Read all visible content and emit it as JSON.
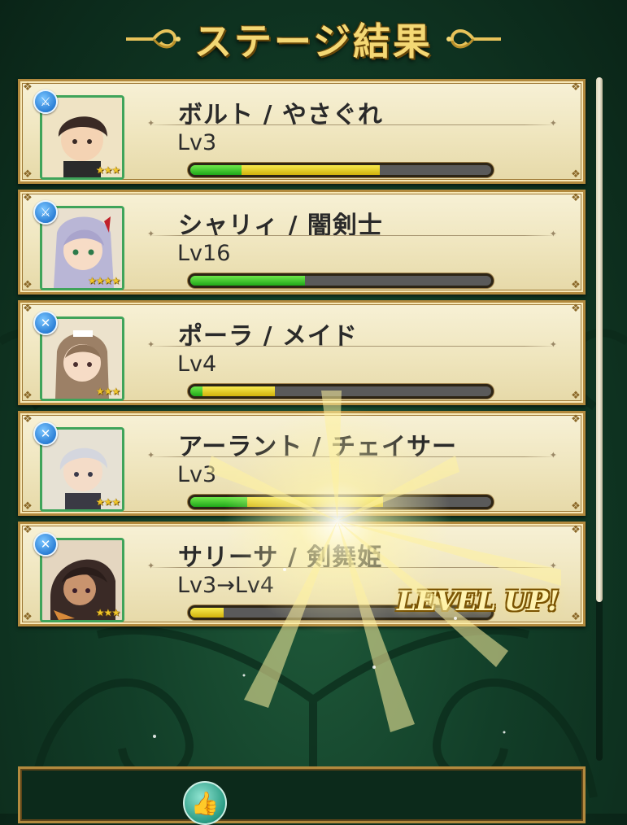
{
  "header": {
    "title": "ステージ結果"
  },
  "characters": [
    {
      "name": "ボルト / やさぐれ",
      "level": "Lv3",
      "stars": "★★★",
      "class_icon": "sword-icon",
      "exp_green": 0.17,
      "exp_yellow": 0.46
    },
    {
      "name": "シャリィ / 闇剣士",
      "level": "Lv16",
      "stars": "★★★★",
      "class_icon": "sword-icon",
      "exp_green": 0.38,
      "exp_yellow": 0
    },
    {
      "name": "ポーラ / メイド",
      "level": "Lv4",
      "stars": "★★★",
      "class_icon": "crossed-swords-icon",
      "exp_green": 0.04,
      "exp_yellow": 0.24
    },
    {
      "name": "アーラント / チェイサー",
      "level": "Lv3",
      "stars": "★★★",
      "class_icon": "crossed-swords-icon",
      "exp_green": 0.19,
      "exp_yellow": 0.45
    },
    {
      "name": "サリーサ / 剣舞姫",
      "level": "Lv3→Lv4",
      "stars": "★★★",
      "class_icon": "crossed-swords-icon",
      "exp_green": 0,
      "exp_yellow": 0.11,
      "badge": "LEVEL UP!"
    }
  ],
  "colors": {
    "bar_green": "#3fd027",
    "bar_yellow": "#e9d32a",
    "title_gold": "#f4d874"
  },
  "bottom": {
    "button_icon": "thumbs-up-icon"
  }
}
